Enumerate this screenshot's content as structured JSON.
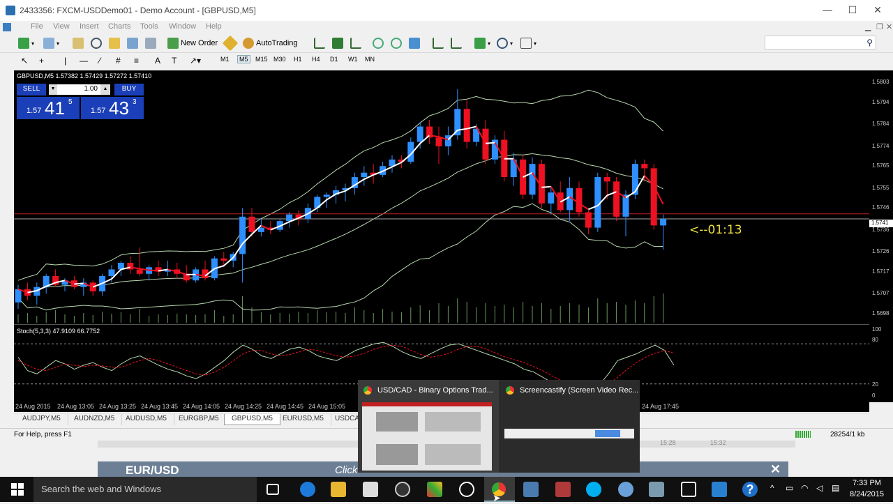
{
  "window": {
    "title": "2433356: FXCM-USDDemo01 - Demo Account - [GBPUSD,M5]",
    "controls": [
      "—",
      "☐",
      "✕"
    ]
  },
  "menu": [
    "File",
    "View",
    "Insert",
    "Charts",
    "Tools",
    "Window",
    "Help"
  ],
  "toolbar": {
    "new_order": "New Order",
    "autotrading": "AutoTrading",
    "timeframes": [
      "M1",
      "M5",
      "M15",
      "M30",
      "H1",
      "H4",
      "D1",
      "W1",
      "MN"
    ],
    "active_timeframe": "M5"
  },
  "chart": {
    "header": "GBPUSD,M5  1.57382 1.57429 1.57272 1.57410",
    "trade_panel": {
      "sell": "SELL",
      "buy": "BUY",
      "lot": "1.00",
      "bid_prefix": "1.57",
      "bid_big": "41",
      "bid_sup": "5",
      "ask_prefix": "1.57",
      "ask_big": "43",
      "ask_sup": "3"
    },
    "countdown": "<--01:13",
    "current_price_label": "1.5741",
    "price_ticks": [
      "1.5803",
      "1.5794",
      "1.5784",
      "1.5774",
      "1.5765",
      "1.5755",
      "1.5746",
      "1.5736",
      "1.5726",
      "1.5717",
      "1.5707",
      "1.5698"
    ],
    "stoch_label": "Stoch(5,3,3) 47.9109 66.7752",
    "stoch_ticks": [
      "100",
      "80",
      "20",
      "0"
    ],
    "time_ticks": [
      "24 Aug 2015",
      "24 Aug 13:05",
      "24 Aug 13:25",
      "24 Aug 13:45",
      "24 Aug 14:05",
      "24 Aug 14:25",
      "24 Aug 14:45",
      "24 Aug 15:05",
      "24 Aug 17:45"
    ]
  },
  "chart_data": {
    "type": "candlestick",
    "symbol": "GBPUSD",
    "timeframe": "M5",
    "ylim": [
      1.5695,
      1.5806
    ],
    "candles": [
      [
        1.5703,
        1.5711,
        1.57,
        1.5709
      ],
      [
        1.5709,
        1.5712,
        1.5704,
        1.5706
      ],
      [
        1.5706,
        1.5712,
        1.5702,
        1.571
      ],
      [
        1.571,
        1.5716,
        1.5707,
        1.5715
      ],
      [
        1.5715,
        1.5718,
        1.571,
        1.5711
      ],
      [
        1.5711,
        1.5714,
        1.5708,
        1.5713
      ],
      [
        1.5713,
        1.5715,
        1.5709,
        1.571
      ],
      [
        1.571,
        1.5714,
        1.5706,
        1.5712
      ],
      [
        1.5712,
        1.5713,
        1.5706,
        1.5708
      ],
      [
        1.5708,
        1.5716,
        1.5706,
        1.5715
      ],
      [
        1.5715,
        1.572,
        1.5712,
        1.5718
      ],
      [
        1.5718,
        1.5722,
        1.5715,
        1.5721
      ],
      [
        1.5721,
        1.5724,
        1.5716,
        1.5718
      ],
      [
        1.5718,
        1.5728,
        1.5715,
        1.5716
      ],
      [
        1.5716,
        1.572,
        1.5713,
        1.5719
      ],
      [
        1.5719,
        1.5722,
        1.5715,
        1.5717
      ],
      [
        1.5717,
        1.5722,
        1.5715,
        1.5718
      ],
      [
        1.5718,
        1.5721,
        1.5714,
        1.5716
      ],
      [
        1.5716,
        1.572,
        1.5712,
        1.5713
      ],
      [
        1.5713,
        1.5719,
        1.5712,
        1.5718
      ],
      [
        1.5718,
        1.5722,
        1.5713,
        1.5714
      ],
      [
        1.5714,
        1.5724,
        1.5713,
        1.5723
      ],
      [
        1.5723,
        1.5726,
        1.5719,
        1.5722
      ],
      [
        1.5722,
        1.5726,
        1.5719,
        1.5725
      ],
      [
        1.5725,
        1.5746,
        1.5712,
        1.5742
      ],
      [
        1.5742,
        1.5746,
        1.5733,
        1.5735
      ],
      [
        1.5735,
        1.5741,
        1.5733,
        1.5737
      ],
      [
        1.5737,
        1.574,
        1.5734,
        1.5736
      ],
      [
        1.5736,
        1.5741,
        1.5735,
        1.574
      ],
      [
        1.574,
        1.5744,
        1.5737,
        1.5743
      ],
      [
        1.5743,
        1.5745,
        1.5738,
        1.5741
      ],
      [
        1.5741,
        1.5748,
        1.5739,
        1.5746
      ],
      [
        1.5746,
        1.5752,
        1.5744,
        1.5751
      ],
      [
        1.5751,
        1.5753,
        1.5746,
        1.5752
      ],
      [
        1.5752,
        1.5756,
        1.5748,
        1.5754
      ],
      [
        1.5754,
        1.5757,
        1.5749,
        1.5755
      ],
      [
        1.5755,
        1.5762,
        1.5752,
        1.576
      ],
      [
        1.576,
        1.5765,
        1.5756,
        1.5762
      ],
      [
        1.5762,
        1.5766,
        1.5757,
        1.5761
      ],
      [
        1.5761,
        1.5767,
        1.576,
        1.5765
      ],
      [
        1.5765,
        1.577,
        1.5762,
        1.5768
      ],
      [
        1.5768,
        1.577,
        1.5764,
        1.5767
      ],
      [
        1.5767,
        1.5778,
        1.5766,
        1.5776
      ],
      [
        1.5776,
        1.5785,
        1.5773,
        1.5783
      ],
      [
        1.5783,
        1.5786,
        1.5775,
        1.5778
      ],
      [
        1.5778,
        1.5783,
        1.5766,
        1.5774
      ],
      [
        1.5774,
        1.5783,
        1.577,
        1.5779
      ],
      [
        1.5779,
        1.58,
        1.5777,
        1.5791
      ],
      [
        1.5791,
        1.5795,
        1.5773,
        1.5776
      ],
      [
        1.5776,
        1.5784,
        1.5774,
        1.5782
      ],
      [
        1.5782,
        1.5786,
        1.5766,
        1.5768
      ],
      [
        1.5768,
        1.5779,
        1.5766,
        1.5777
      ],
      [
        1.5777,
        1.5781,
        1.5758,
        1.576
      ],
      [
        1.576,
        1.5771,
        1.5756,
        1.5768
      ],
      [
        1.5768,
        1.577,
        1.575,
        1.5752
      ],
      [
        1.5752,
        1.5769,
        1.575,
        1.5766
      ],
      [
        1.5766,
        1.5768,
        1.5746,
        1.5748
      ],
      [
        1.5748,
        1.5755,
        1.5743,
        1.5753
      ],
      [
        1.5753,
        1.5758,
        1.5744,
        1.5745
      ],
      [
        1.5745,
        1.576,
        1.574,
        1.5755
      ],
      [
        1.5755,
        1.5758,
        1.5742,
        1.5744
      ],
      [
        1.5744,
        1.5745,
        1.5734,
        1.5737
      ],
      [
        1.5737,
        1.5762,
        1.5735,
        1.576
      ],
      [
        1.576,
        1.5762,
        1.575,
        1.5758
      ],
      [
        1.5758,
        1.576,
        1.574,
        1.5742
      ],
      [
        1.5742,
        1.5754,
        1.5733,
        1.5752
      ],
      [
        1.5752,
        1.5768,
        1.575,
        1.5766
      ],
      [
        1.5766,
        1.5768,
        1.5758,
        1.5764
      ],
      [
        1.5764,
        1.5766,
        1.5736,
        1.5738
      ],
      [
        1.5738,
        1.5743,
        1.5727,
        1.5741
      ]
    ],
    "stochastic": {
      "main": [
        60,
        40,
        35,
        45,
        55,
        50,
        42,
        48,
        52,
        45,
        40,
        50,
        58,
        62,
        55,
        48,
        42,
        38,
        32,
        28,
        35,
        45,
        55,
        68,
        78,
        72,
        62,
        58,
        65,
        72,
        75,
        70,
        62,
        58,
        55,
        62,
        70,
        75,
        80,
        82,
        76,
        68,
        62,
        58,
        65,
        72,
        78,
        80,
        75,
        70,
        65,
        60,
        55,
        50,
        42,
        38,
        30,
        22,
        18,
        15,
        12,
        14,
        18,
        35,
        55,
        60,
        65,
        72,
        78,
        70,
        48
      ],
      "signal": [
        55,
        48,
        42,
        40,
        45,
        50,
        48,
        46,
        48,
        47,
        45,
        45,
        50,
        55,
        58,
        55,
        50,
        45,
        40,
        35,
        33,
        38,
        45,
        55,
        65,
        70,
        70,
        65,
        62,
        64,
        68,
        72,
        70,
        66,
        62,
        60,
        62,
        66,
        72,
        76,
        78,
        76,
        70,
        64,
        60,
        62,
        66,
        72,
        76,
        76,
        72,
        66,
        60,
        56,
        52,
        46,
        40,
        32,
        25,
        20,
        16,
        14,
        14,
        20,
        30,
        42,
        52,
        60,
        66,
        70,
        66
      ]
    },
    "volume": [
      12,
      14,
      10,
      15,
      18,
      12,
      10,
      14,
      11,
      16,
      13,
      15,
      12,
      20,
      10,
      12,
      11,
      13,
      12,
      11,
      12,
      18,
      10,
      12,
      38,
      22,
      15,
      12,
      14,
      13,
      16,
      14,
      18,
      15,
      16,
      14,
      22,
      18,
      14,
      20,
      16,
      15,
      22,
      25,
      18,
      28,
      24,
      35,
      30,
      22,
      28,
      24,
      26,
      22,
      30,
      24,
      28,
      20,
      24,
      28,
      26,
      22,
      35,
      28,
      30,
      26,
      32,
      28,
      38,
      42
    ],
    "reference_lines": {
      "bid": 1.5741,
      "ask": 1.57433
    }
  },
  "tabs": [
    "AUDJPY,M5",
    "AUDNZD,M5",
    "AUDUSD,M5",
    "EURGBP,M5",
    "GBPUSD,M5",
    "EURUSD,M5",
    "USDCA"
  ],
  "active_tab": "GBPUSD,M5",
  "status": {
    "help": "For Help, press F1",
    "traffic": "28254/1 kb",
    "bg_times": [
      "15:28",
      "15:32"
    ]
  },
  "background_page": {
    "pair": "EUR/USD",
    "click": "Click"
  },
  "thumbnails": [
    {
      "title": "USD/CAD - Binary Options Trad..."
    },
    {
      "title": "Screencastify (Screen Video Rec..."
    }
  ],
  "taskbar": {
    "search_placeholder": "Search the web and Windows",
    "time": "7:33 PM",
    "date": "8/24/2015"
  },
  "colors": {
    "bull": "#2e8fff",
    "bear": "#ee1122",
    "ma": "#ffffff",
    "band": "#b8d8b0",
    "countdown": "#f0e040"
  }
}
